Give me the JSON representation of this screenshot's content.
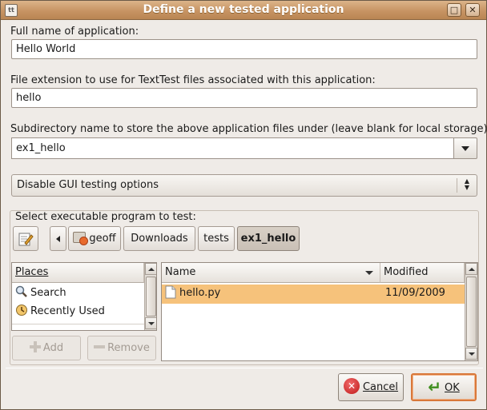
{
  "window": {
    "title": "Define a new tested application",
    "app_icon": "texttest-app-icon",
    "controls": {
      "maximize": "□",
      "close": "✕"
    }
  },
  "form": {
    "full_name_label": "Full name of application:",
    "full_name_value": "Hello World",
    "extension_label": "File extension to use for TextTest files associated with this application:",
    "extension_value": "hello",
    "subdir_label": "Subdirectory name to store the above application files under (leave blank for local storage):",
    "subdir_value": "ex1_hello",
    "gui_option": "Disable GUI testing options"
  },
  "chooser": {
    "frame_label": "Select executable program to test:",
    "path_buttons": [
      "geoff",
      "Downloads",
      "tests",
      "ex1_hello"
    ],
    "active_path": "ex1_hello",
    "places": {
      "header": "Places",
      "items": [
        {
          "label": "Search",
          "icon": "search-icon"
        },
        {
          "label": "Recently Used",
          "icon": "recently-used-icon"
        }
      ],
      "add_label": "Add",
      "remove_label": "Remove"
    },
    "files": {
      "col_name": "Name",
      "col_modified": "Modified",
      "rows": [
        {
          "name": "hello.py",
          "modified": "11/09/2009",
          "selected": true
        }
      ]
    }
  },
  "buttons": {
    "cancel": "Cancel",
    "ok": "OK"
  },
  "colors": {
    "title_bar": "#c79463",
    "selection": "#f6c27b",
    "default_button_border": "#d9783a"
  }
}
